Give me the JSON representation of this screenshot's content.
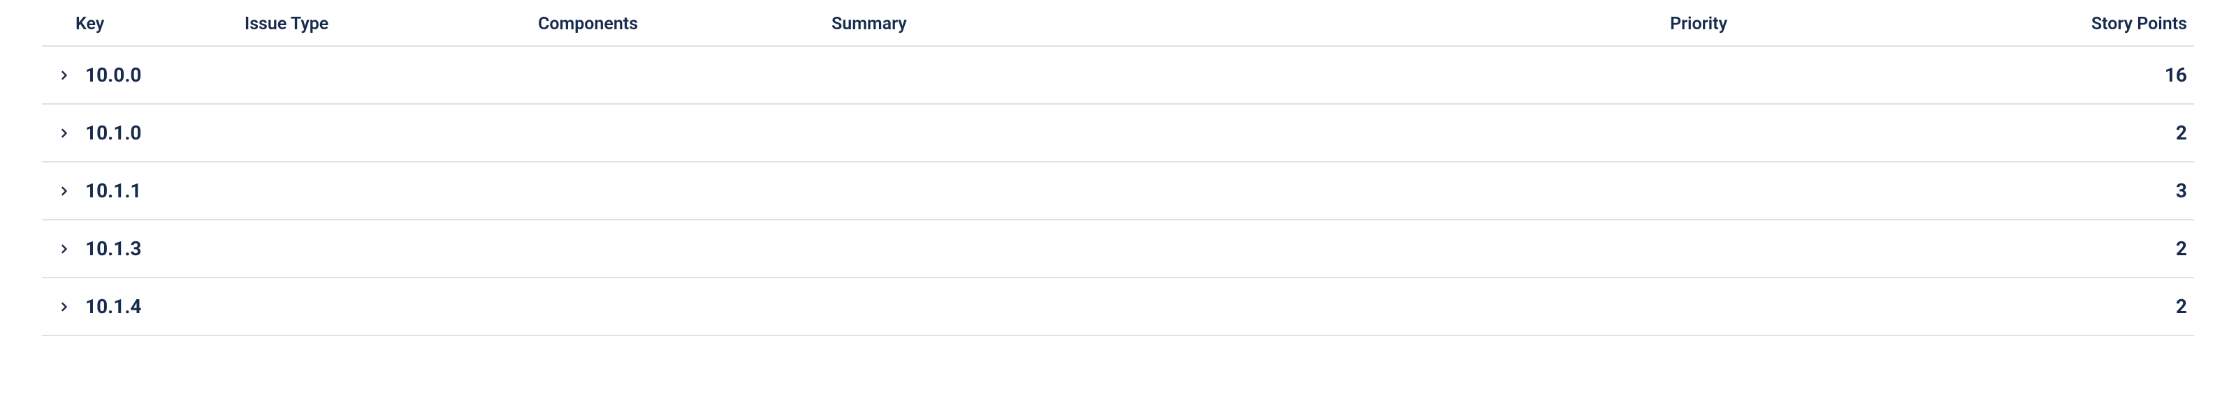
{
  "columns": {
    "key": "Key",
    "issue_type": "Issue Type",
    "components": "Components",
    "summary": "Summary",
    "priority": "Priority",
    "story_points": "Story Points"
  },
  "groups": [
    {
      "label": "10.0.0",
      "story_points": "16"
    },
    {
      "label": "10.1.0",
      "story_points": "2"
    },
    {
      "label": "10.1.1",
      "story_points": "3"
    },
    {
      "label": "10.1.3",
      "story_points": "2"
    },
    {
      "label": "10.1.4",
      "story_points": "2"
    }
  ]
}
